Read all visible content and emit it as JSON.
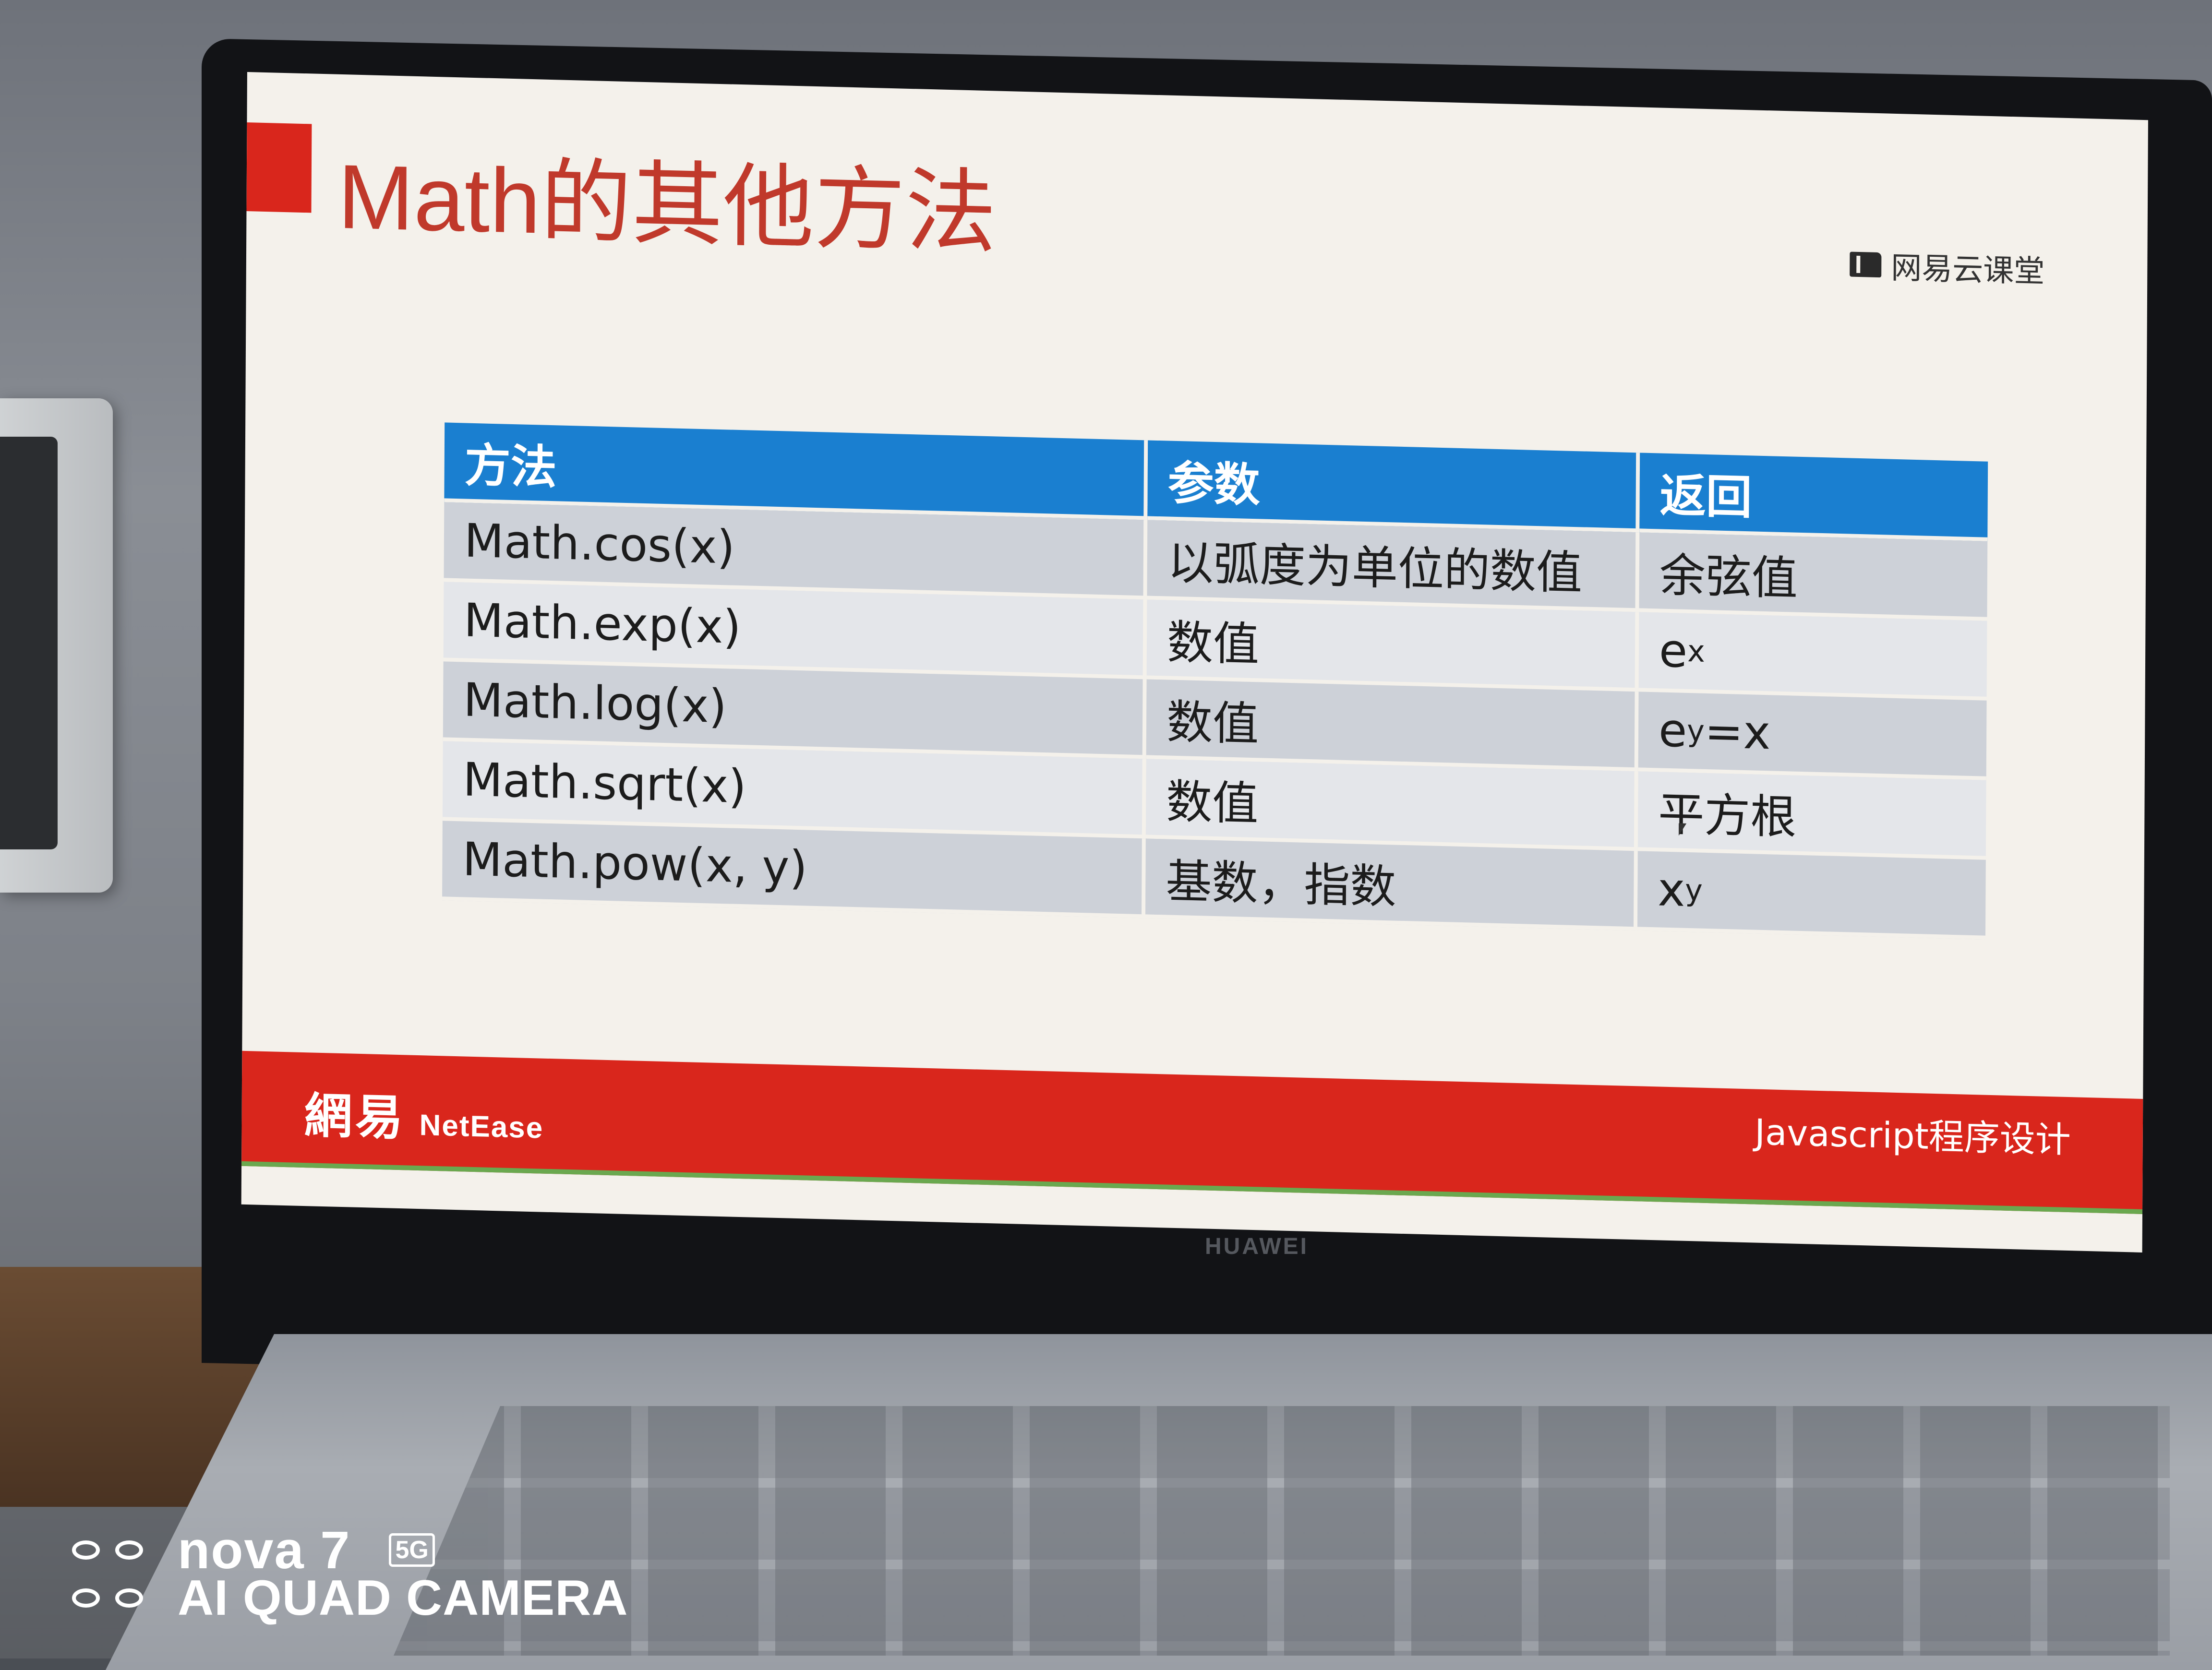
{
  "slide": {
    "title": "Math的其他方法",
    "logo_text": "网易云课堂",
    "table": {
      "headers": [
        "方法",
        "参数",
        "返回"
      ],
      "rows": [
        {
          "method": "Math.cos(x)",
          "param": "以弧度为单位的数值",
          "return_base": "余弦值",
          "return_sup": "",
          "return_tail": ""
        },
        {
          "method": "Math.exp(x)",
          "param": "数值",
          "return_base": "e",
          "return_sup": "x",
          "return_tail": ""
        },
        {
          "method": "Math.log(x)",
          "param": "数值",
          "return_base": "e",
          "return_sup": "y",
          "return_tail": "=x"
        },
        {
          "method": "Math.sqrt(x)",
          "param": "数值",
          "return_base": "平方根",
          "return_sup": "",
          "return_tail": ""
        },
        {
          "method": "Math.pow(x, y)",
          "param": "基数，指数",
          "return_base": "x",
          "return_sup": "y",
          "return_tail": ""
        }
      ]
    },
    "footer": {
      "logo_cn": "網易",
      "logo_en": "NetEase",
      "course": "Javascript程序设计"
    }
  },
  "laptop": {
    "brand": "HUAWEI"
  },
  "watermark": {
    "model": "nova 7",
    "network": "5G",
    "camera": "AI QUAD CAMERA"
  },
  "colors": {
    "accent_red": "#d9261c",
    "title_red": "#c0392b",
    "header_blue": "#1a7fd0"
  }
}
